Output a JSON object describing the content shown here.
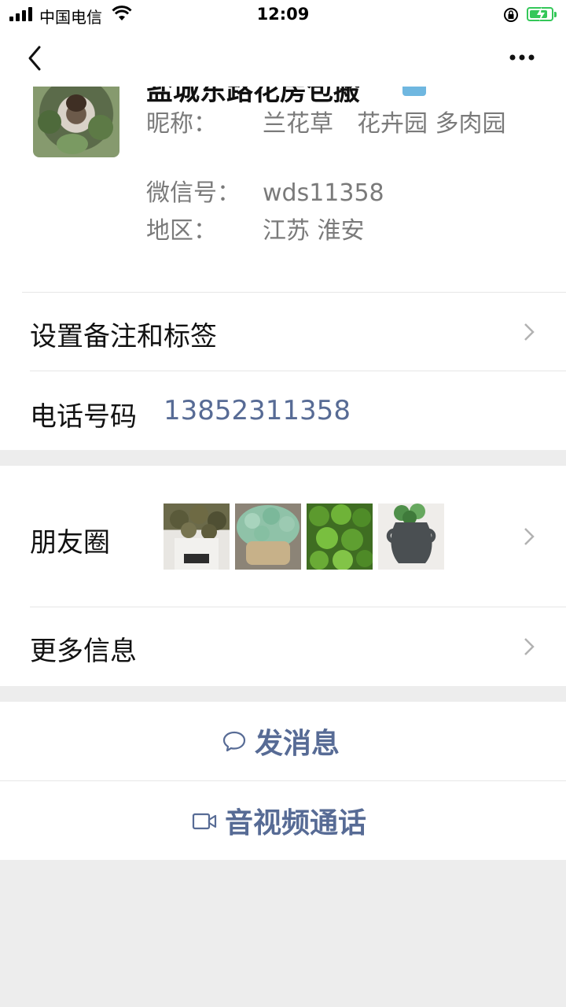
{
  "status_bar": {
    "carrier": "中国电信",
    "time": "12:09",
    "battery_level": 0.85,
    "icons": [
      "signal-icon",
      "wifi-icon",
      "rotation-lock-icon",
      "battery-charging-icon"
    ]
  },
  "nav": {
    "back_icon": "back-chevron-icon",
    "more_icon": "more-dots-icon"
  },
  "profile": {
    "display_name": "盐城东路花房包搬",
    "verified_icon": "verified-badge-icon",
    "nickname_label": "昵称：",
    "nickname_value": "兰花草　花卉园  多肉园",
    "wechat_id_label": "微信号：",
    "wechat_id_value": "wds11358",
    "region_label": "地区：",
    "region_value": "江苏 淮安"
  },
  "rows": {
    "remarks_label": "设置备注和标签",
    "phone_label": "电话号码",
    "phone_value": "13852311358",
    "moments_label": "朋友圈",
    "more_info_label": "更多信息"
  },
  "actions": {
    "message_label": "发消息",
    "message_icon": "chat-bubble-icon",
    "call_label": "音视频通话",
    "call_icon": "video-camera-icon"
  },
  "colors": {
    "link": "#576b95",
    "background": "#ededed",
    "battery": "#34c759"
  }
}
